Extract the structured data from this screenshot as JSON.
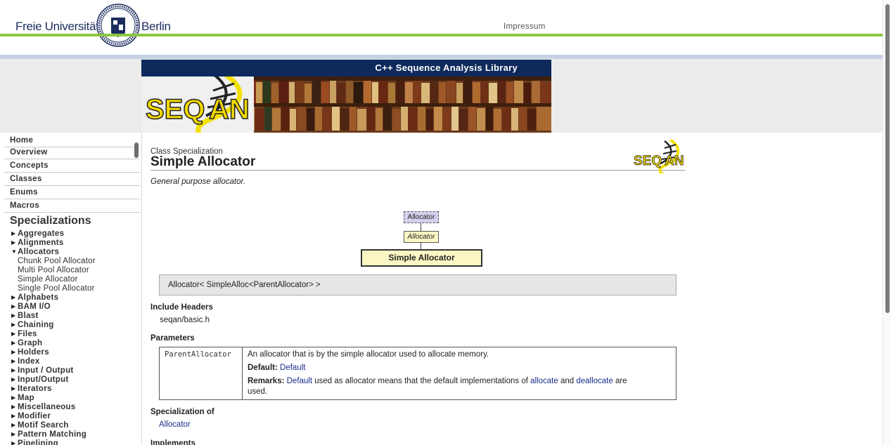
{
  "header": {
    "uni_left": "Freie Universität",
    "uni_right": "Berlin",
    "impressum": "Impressum",
    "seal_icon": "fu-berlin-seal-icon",
    "accent_green": "#8cc63f",
    "accent_blue": "#c6d2e2"
  },
  "banner": {
    "title": "C++ Sequence Analysis Library",
    "logo_text": "SEQAN",
    "bar_color": "#0e2a5c"
  },
  "sidebar": {
    "nav": [
      "Home",
      "Overview",
      "Concepts",
      "Classes",
      "Enums",
      "Macros"
    ],
    "heading": "Specializations",
    "tree": [
      {
        "label": "Aggregates",
        "expanded": false
      },
      {
        "label": "Alignments",
        "expanded": false
      },
      {
        "label": "Allocators",
        "expanded": true,
        "children": [
          "Chunk Pool Allocator",
          "Multi Pool Allocator",
          "Simple Allocator",
          "Single Pool Allocator"
        ]
      },
      {
        "label": "Alphabets",
        "expanded": false
      },
      {
        "label": "BAM I/O",
        "expanded": false
      },
      {
        "label": "Blast",
        "expanded": false
      },
      {
        "label": "Chaining",
        "expanded": false
      },
      {
        "label": "Files",
        "expanded": false
      },
      {
        "label": "Graph",
        "expanded": false
      },
      {
        "label": "Holders",
        "expanded": false
      },
      {
        "label": "Index",
        "expanded": false
      },
      {
        "label": "Input / Output",
        "expanded": false
      },
      {
        "label": "Input/Output",
        "expanded": false
      },
      {
        "label": "Iterators",
        "expanded": false
      },
      {
        "label": "Map",
        "expanded": false
      },
      {
        "label": "Miscellaneous",
        "expanded": false
      },
      {
        "label": "Modifier",
        "expanded": false
      },
      {
        "label": "Motif Search",
        "expanded": false
      },
      {
        "label": "Pattern Matching",
        "expanded": false
      },
      {
        "label": "Pipelining",
        "expanded": false
      }
    ]
  },
  "content": {
    "kind": "Class Specialization",
    "title": "Simple Allocator",
    "summary": "General purpose allocator.",
    "diagram": {
      "concept": "Allocator",
      "spec": "Allocator",
      "main": "Simple Allocator"
    },
    "signature": "Allocator< SimpleAlloc<ParentAllocator> >",
    "include_headers_label": "Include Headers",
    "include_header": "seqan/basic.h",
    "parameters_label": "Parameters",
    "param": {
      "name": "ParentAllocator",
      "description": "An allocator that is by the simple allocator used to allocate memory.",
      "default_label": "Default:",
      "default_value": "Default",
      "remarks_label": "Remarks:",
      "remarks_link1": "Default",
      "remarks_text1": " used as allocator means that the default implementations of ",
      "remarks_link2": "allocate",
      "remarks_text2": " and ",
      "remarks_link3": "deallocate",
      "remarks_text3": " are",
      "remarks_text4": "used."
    },
    "specialization_of_label": "Specialization of",
    "specialization_of": "Allocator",
    "implements_label": "Implements"
  }
}
